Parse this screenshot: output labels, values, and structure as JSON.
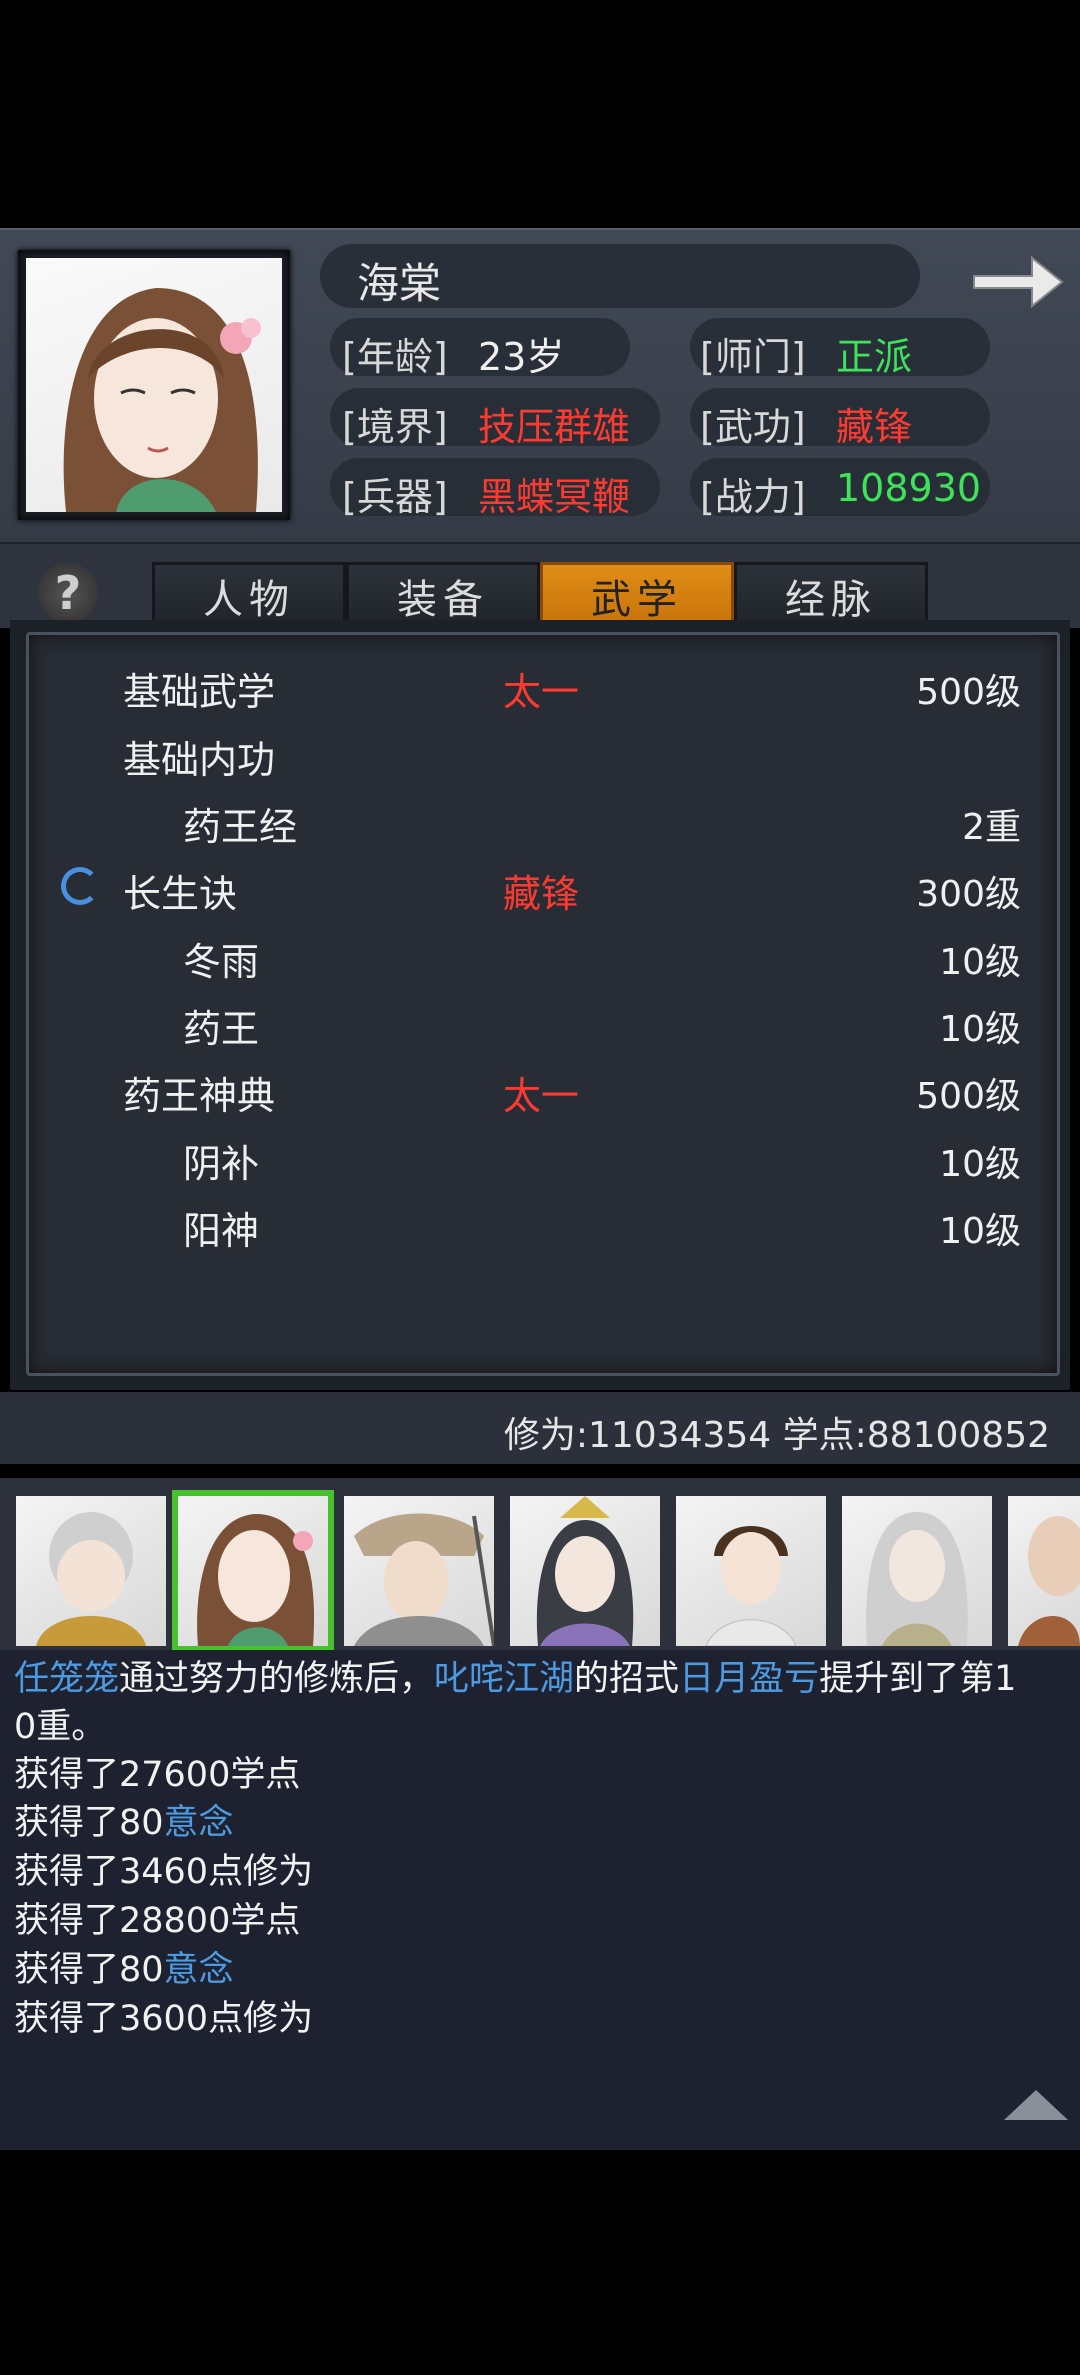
{
  "character": {
    "name": "海棠",
    "age": {
      "label": "[年龄]",
      "value": "23岁"
    },
    "sect": {
      "label": "[师门]",
      "value": "正派"
    },
    "realm": {
      "label": "[境界]",
      "value": "技压群雄"
    },
    "martial": {
      "label": "[武功]",
      "value": "藏锋"
    },
    "weapon": {
      "label": "[兵器]",
      "value": "黑蝶冥鞭"
    },
    "power": {
      "label": "[战力]",
      "value": "108930"
    }
  },
  "colors": {
    "red": "#ff3a30",
    "green": "#3ee35a",
    "orange": "#e08d17",
    "blue": "#4d9ae0"
  },
  "tabs": [
    {
      "label": "人物",
      "active": false
    },
    {
      "label": "装备",
      "active": false
    },
    {
      "label": "武学",
      "active": true
    },
    {
      "label": "经脉",
      "active": false
    }
  ],
  "help_label": "?",
  "skills": [
    {
      "name": "基础武学",
      "rank": "太一",
      "level": "500级",
      "indent": 0
    },
    {
      "name": "基础内功",
      "rank": "",
      "level": "",
      "indent": 0
    },
    {
      "name": "药王经",
      "rank": "",
      "level": "2重",
      "indent": 1
    },
    {
      "name": "长生诀",
      "rank": "藏锋",
      "level": "300级",
      "indent": 0,
      "loading": true
    },
    {
      "name": "冬雨",
      "rank": "",
      "level": "10级",
      "indent": 1
    },
    {
      "name": "药王",
      "rank": "",
      "level": "10级",
      "indent": 1
    },
    {
      "name": "药王神典",
      "rank": "太一",
      "level": "500级",
      "indent": 0
    },
    {
      "name": "阴补",
      "rank": "",
      "level": "10级",
      "indent": 1
    },
    {
      "name": "阳神",
      "rank": "",
      "level": "10级",
      "indent": 1
    }
  ],
  "stats": {
    "text": "修为:11034354  学点:88100852"
  },
  "log": {
    "line1": {
      "a": "任笼笼",
      "b": "通过努力的修炼后，",
      "c": "叱咤江湖",
      "d": "的招式",
      "e": "日月盈亏",
      "f": "提升到了第1"
    },
    "line2": "0重。",
    "line3": "获得了27600学点",
    "line4": {
      "a": "获得了80",
      "b": "意念"
    },
    "line5": "获得了3460点修为",
    "line6": "获得了28800学点",
    "line7": {
      "a": "获得了80",
      "b": "意念"
    },
    "line8": "获得了3600点修为"
  }
}
